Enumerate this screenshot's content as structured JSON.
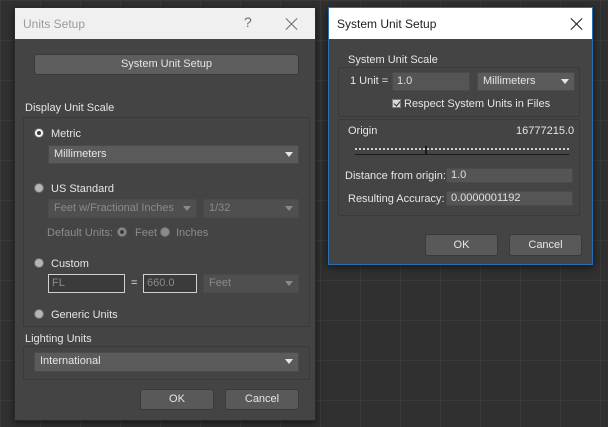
{
  "units_setup": {
    "title": "Units Setup",
    "help_glyph": "?",
    "system_unit_setup_button": "System Unit Setup",
    "display_unit_scale": {
      "label": "Display Unit Scale",
      "metric_label": "Metric",
      "metric_selected": true,
      "metric_value": "Millimeters",
      "us_standard_label": "US Standard",
      "us_standard_value": "Feet w/Fractional Inches",
      "fraction_value": "1/32",
      "default_units_label": "Default Units:",
      "feet_label": "Feet",
      "inches_label": "Inches",
      "custom_label": "Custom",
      "custom_name": "FL",
      "equals": "=",
      "custom_value": "660.0",
      "custom_unit": "Feet",
      "generic_units_label": "Generic Units"
    },
    "lighting_units": {
      "label": "Lighting Units",
      "value": "International"
    },
    "ok_label": "OK",
    "cancel_label": "Cancel"
  },
  "system_unit_setup": {
    "title": "System Unit Setup",
    "scale_label": "System Unit Scale",
    "one_unit_label": "1 Unit =",
    "one_unit_value": "1.0",
    "unit_value": "Millimeters",
    "respect_label": "Respect System Units in Files",
    "respect_checked": true,
    "origin_label": "Origin",
    "origin_value": "16777215.0",
    "distance_label": "Distance from origin:",
    "distance_value": "1.0",
    "accuracy_label": "Resulting Accuracy:",
    "accuracy_value": "0.0000001192",
    "ok_label": "OK",
    "cancel_label": "Cancel"
  },
  "colors": {
    "dialog_bg": "#444444",
    "active_border": "#2a6fb5",
    "button_bg": "#595959"
  }
}
